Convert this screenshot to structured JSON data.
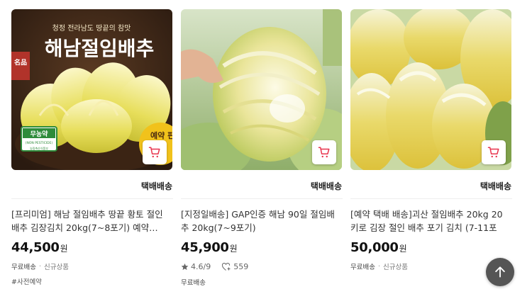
{
  "products": [
    {
      "image_banner_small": "청정 전라남도 땅끝의 참맛",
      "image_banner_big": "해남절임배추",
      "image_seal": "名品",
      "image_badge_main": "무농약",
      "image_badge_en": "(NON PESTICIDE)",
      "image_badge_sub": "농림축산식품부",
      "image_corner_text": "예약 판",
      "shipping": "택배배송",
      "title": "[프리미엄] 해남 절임배추 땅끝 황토 절인 배추 김장김치 20kg(7~8포기) 예약…",
      "price": "44,500",
      "currency": "원",
      "tag_primary": "무료배송",
      "tag_secondary": "신규상품",
      "extra_tag": "#사전예약"
    },
    {
      "shipping": "택배배송",
      "title": "[지정일배송] GAP인증 해남 90일 절임배추 20kg(7~9포기)",
      "price": "45,900",
      "currency": "원",
      "rating": "4.6",
      "rating_max": "/9",
      "heart_count": "559",
      "tag_primary": "무료배송"
    },
    {
      "shipping": "택배배송",
      "title": "[예약 택배 배송]괴산 절임배추 20kg 20키로 김장 절인 배추 포기 김치 (7-11포",
      "price": "50,000",
      "currency": "원",
      "tag_primary": "무료배송",
      "tag_secondary": "신규상품"
    }
  ],
  "icons": {
    "cart": "cart-icon",
    "star": "star-icon",
    "heart": "heart-plus-icon",
    "scroll_top": "arrow-up-icon"
  },
  "colors": {
    "cart_accent": "#e8344e",
    "scroll_top_bg": "#555555"
  }
}
